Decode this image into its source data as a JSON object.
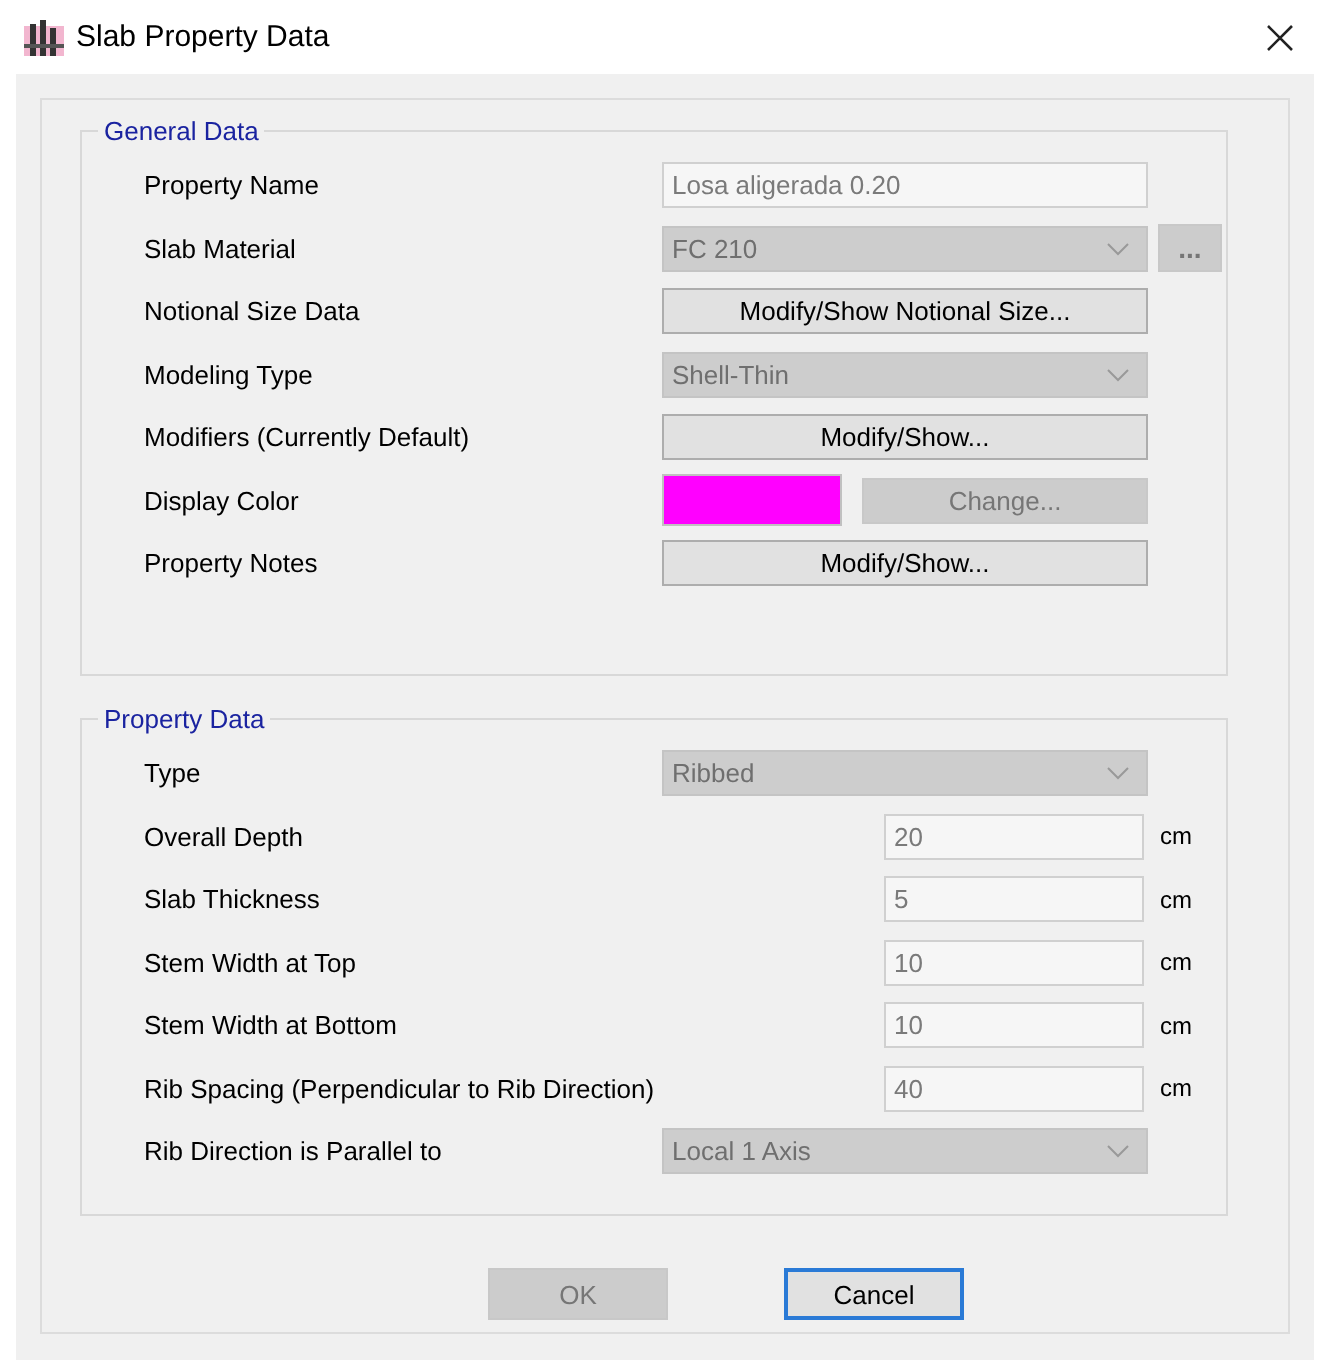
{
  "window": {
    "title": "Slab Property Data"
  },
  "general_data": {
    "title": "General Data",
    "rows": [
      {
        "label": "Property Name",
        "kind": "text",
        "value": "Losa aligerada 0.20",
        "disabled": true
      },
      {
        "label": "Slab Material",
        "kind": "combo",
        "value": "FC 210",
        "disabled": true,
        "extra_button": {
          "label": "...",
          "disabled": true
        }
      },
      {
        "label": "Notional Size Data",
        "kind": "button",
        "button": "Modify/Show Notional Size...",
        "disabled": false
      },
      {
        "label": "Modeling Type",
        "kind": "combo",
        "value": "Shell-Thin",
        "disabled": true
      },
      {
        "label": "Modifiers (Currently Default)",
        "kind": "button",
        "button": "Modify/Show...",
        "disabled": false
      },
      {
        "label": "Display Color",
        "kind": "color",
        "color": "#ff00ff",
        "button": "Change...",
        "disabled": true
      },
      {
        "label": "Property Notes",
        "kind": "button",
        "button": "Modify/Show...",
        "disabled": false
      }
    ]
  },
  "property_data": {
    "title": "Property Data",
    "rows": [
      {
        "label": "Type",
        "kind": "combo",
        "value": "Ribbed",
        "disabled": true
      },
      {
        "label": "Overall Depth",
        "kind": "number",
        "value": "20",
        "unit": "cm",
        "disabled": true
      },
      {
        "label": "Slab Thickness",
        "kind": "number",
        "value": "5",
        "unit": "cm",
        "disabled": true
      },
      {
        "label": "Stem Width at Top",
        "kind": "number",
        "value": "10",
        "unit": "cm",
        "disabled": true
      },
      {
        "label": "Stem Width at Bottom",
        "kind": "number",
        "value": "10",
        "unit": "cm",
        "disabled": true
      },
      {
        "label": "Rib Spacing (Perpendicular to Rib Direction)",
        "kind": "number",
        "value": "40",
        "unit": "cm",
        "disabled": true
      },
      {
        "label": "Rib Direction is Parallel to",
        "kind": "combo",
        "value": "Local 1 Axis",
        "disabled": true
      }
    ]
  },
  "buttons": [
    {
      "label": "OK",
      "disabled": true,
      "default": false
    },
    {
      "label": "Cancel",
      "disabled": false,
      "default": true
    }
  ]
}
